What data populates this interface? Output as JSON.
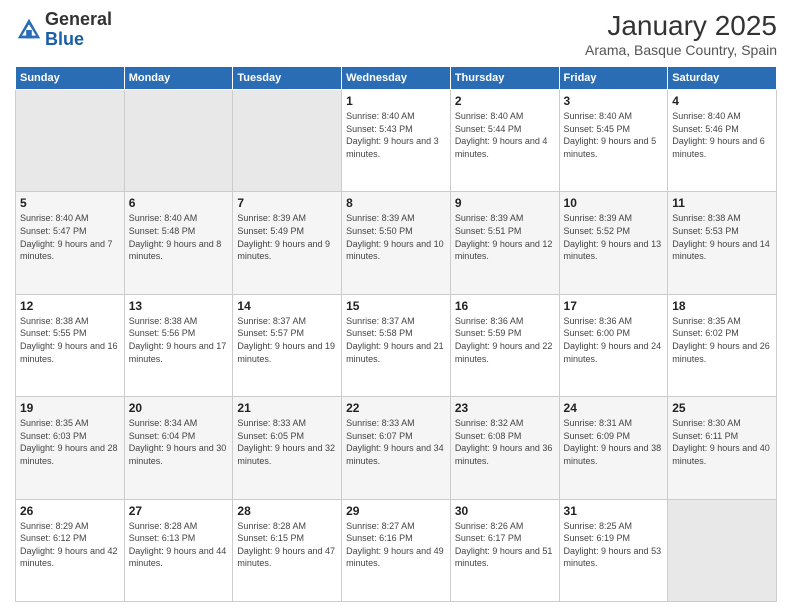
{
  "logo": {
    "general": "General",
    "blue": "Blue"
  },
  "header": {
    "title": "January 2025",
    "subtitle": "Arama, Basque Country, Spain"
  },
  "weekdays": [
    "Sunday",
    "Monday",
    "Tuesday",
    "Wednesday",
    "Thursday",
    "Friday",
    "Saturday"
  ],
  "weeks": [
    [
      {
        "day": "",
        "info": ""
      },
      {
        "day": "",
        "info": ""
      },
      {
        "day": "",
        "info": ""
      },
      {
        "day": "1",
        "info": "Sunrise: 8:40 AM\nSunset: 5:43 PM\nDaylight: 9 hours and 3 minutes."
      },
      {
        "day": "2",
        "info": "Sunrise: 8:40 AM\nSunset: 5:44 PM\nDaylight: 9 hours and 4 minutes."
      },
      {
        "day": "3",
        "info": "Sunrise: 8:40 AM\nSunset: 5:45 PM\nDaylight: 9 hours and 5 minutes."
      },
      {
        "day": "4",
        "info": "Sunrise: 8:40 AM\nSunset: 5:46 PM\nDaylight: 9 hours and 6 minutes."
      }
    ],
    [
      {
        "day": "5",
        "info": "Sunrise: 8:40 AM\nSunset: 5:47 PM\nDaylight: 9 hours and 7 minutes."
      },
      {
        "day": "6",
        "info": "Sunrise: 8:40 AM\nSunset: 5:48 PM\nDaylight: 9 hours and 8 minutes."
      },
      {
        "day": "7",
        "info": "Sunrise: 8:39 AM\nSunset: 5:49 PM\nDaylight: 9 hours and 9 minutes."
      },
      {
        "day": "8",
        "info": "Sunrise: 8:39 AM\nSunset: 5:50 PM\nDaylight: 9 hours and 10 minutes."
      },
      {
        "day": "9",
        "info": "Sunrise: 8:39 AM\nSunset: 5:51 PM\nDaylight: 9 hours and 12 minutes."
      },
      {
        "day": "10",
        "info": "Sunrise: 8:39 AM\nSunset: 5:52 PM\nDaylight: 9 hours and 13 minutes."
      },
      {
        "day": "11",
        "info": "Sunrise: 8:38 AM\nSunset: 5:53 PM\nDaylight: 9 hours and 14 minutes."
      }
    ],
    [
      {
        "day": "12",
        "info": "Sunrise: 8:38 AM\nSunset: 5:55 PM\nDaylight: 9 hours and 16 minutes."
      },
      {
        "day": "13",
        "info": "Sunrise: 8:38 AM\nSunset: 5:56 PM\nDaylight: 9 hours and 17 minutes."
      },
      {
        "day": "14",
        "info": "Sunrise: 8:37 AM\nSunset: 5:57 PM\nDaylight: 9 hours and 19 minutes."
      },
      {
        "day": "15",
        "info": "Sunrise: 8:37 AM\nSunset: 5:58 PM\nDaylight: 9 hours and 21 minutes."
      },
      {
        "day": "16",
        "info": "Sunrise: 8:36 AM\nSunset: 5:59 PM\nDaylight: 9 hours and 22 minutes."
      },
      {
        "day": "17",
        "info": "Sunrise: 8:36 AM\nSunset: 6:00 PM\nDaylight: 9 hours and 24 minutes."
      },
      {
        "day": "18",
        "info": "Sunrise: 8:35 AM\nSunset: 6:02 PM\nDaylight: 9 hours and 26 minutes."
      }
    ],
    [
      {
        "day": "19",
        "info": "Sunrise: 8:35 AM\nSunset: 6:03 PM\nDaylight: 9 hours and 28 minutes."
      },
      {
        "day": "20",
        "info": "Sunrise: 8:34 AM\nSunset: 6:04 PM\nDaylight: 9 hours and 30 minutes."
      },
      {
        "day": "21",
        "info": "Sunrise: 8:33 AM\nSunset: 6:05 PM\nDaylight: 9 hours and 32 minutes."
      },
      {
        "day": "22",
        "info": "Sunrise: 8:33 AM\nSunset: 6:07 PM\nDaylight: 9 hours and 34 minutes."
      },
      {
        "day": "23",
        "info": "Sunrise: 8:32 AM\nSunset: 6:08 PM\nDaylight: 9 hours and 36 minutes."
      },
      {
        "day": "24",
        "info": "Sunrise: 8:31 AM\nSunset: 6:09 PM\nDaylight: 9 hours and 38 minutes."
      },
      {
        "day": "25",
        "info": "Sunrise: 8:30 AM\nSunset: 6:11 PM\nDaylight: 9 hours and 40 minutes."
      }
    ],
    [
      {
        "day": "26",
        "info": "Sunrise: 8:29 AM\nSunset: 6:12 PM\nDaylight: 9 hours and 42 minutes."
      },
      {
        "day": "27",
        "info": "Sunrise: 8:28 AM\nSunset: 6:13 PM\nDaylight: 9 hours and 44 minutes."
      },
      {
        "day": "28",
        "info": "Sunrise: 8:28 AM\nSunset: 6:15 PM\nDaylight: 9 hours and 47 minutes."
      },
      {
        "day": "29",
        "info": "Sunrise: 8:27 AM\nSunset: 6:16 PM\nDaylight: 9 hours and 49 minutes."
      },
      {
        "day": "30",
        "info": "Sunrise: 8:26 AM\nSunset: 6:17 PM\nDaylight: 9 hours and 51 minutes."
      },
      {
        "day": "31",
        "info": "Sunrise: 8:25 AM\nSunset: 6:19 PM\nDaylight: 9 hours and 53 minutes."
      },
      {
        "day": "",
        "info": ""
      }
    ]
  ]
}
